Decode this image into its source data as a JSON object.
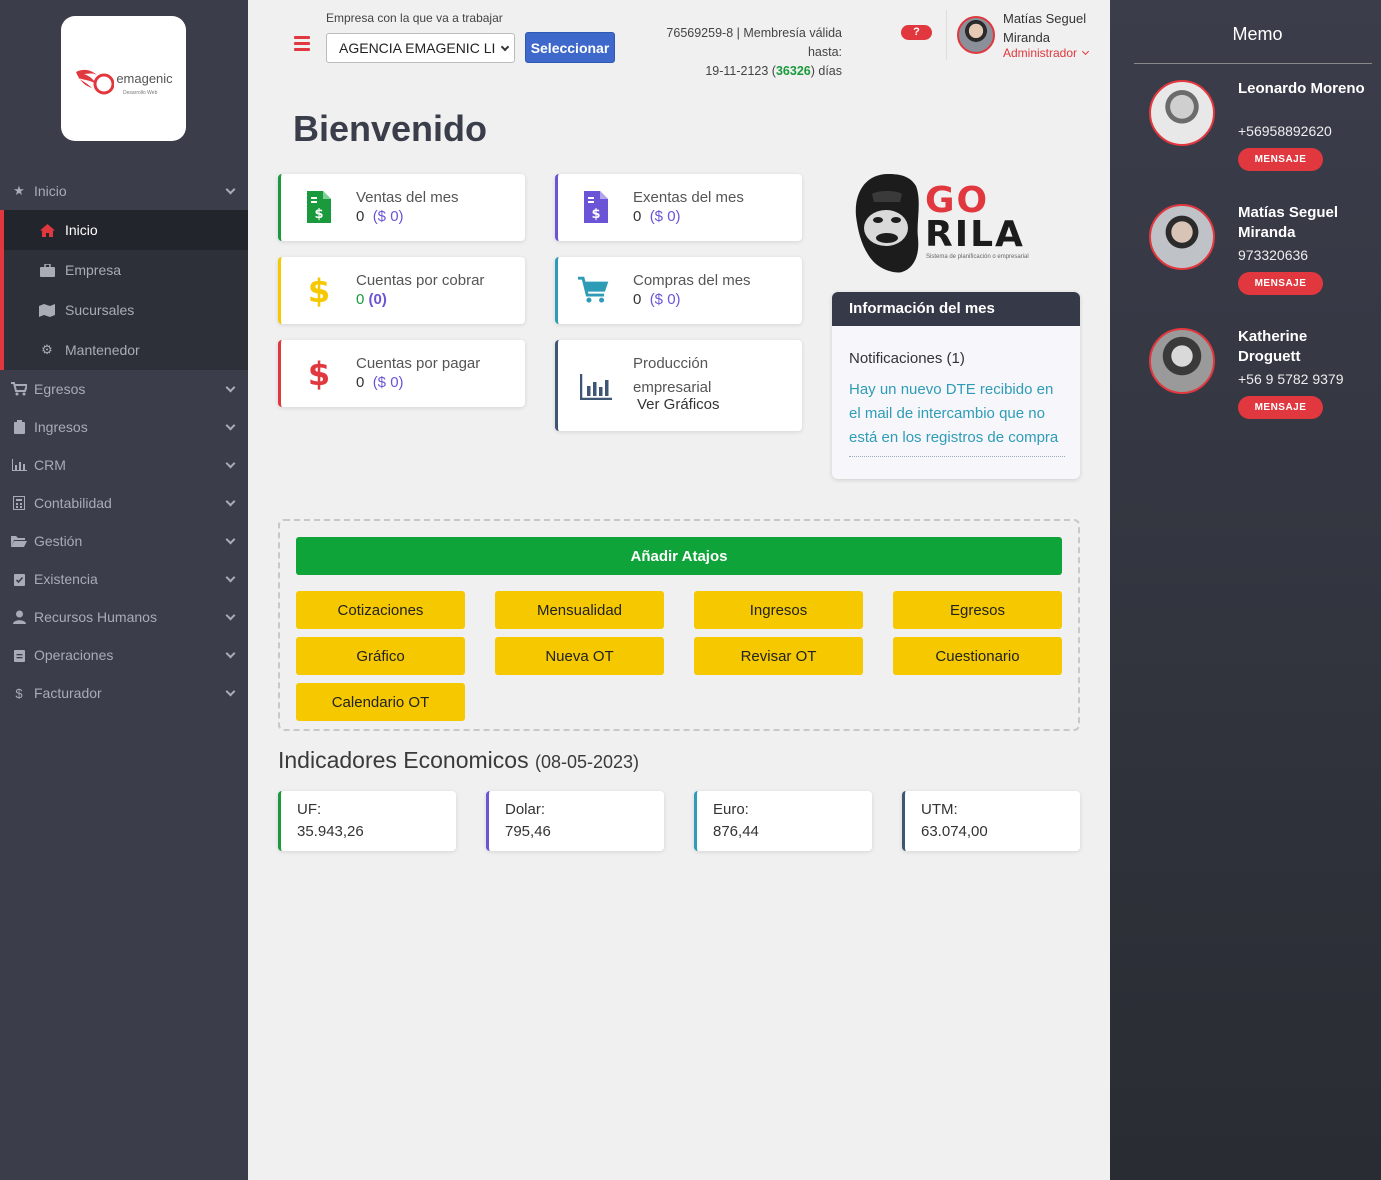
{
  "brand": {
    "logo_text": "emagenic",
    "logo_sub": "Desarrollo Web",
    "accent": "#e0383e"
  },
  "sidebar": {
    "groups": [
      {
        "label": "Inicio",
        "icon": "star-icon"
      },
      {
        "label": "Egresos",
        "icon": "cart-icon"
      },
      {
        "label": "Ingresos",
        "icon": "clipboard-icon"
      },
      {
        "label": "CRM",
        "icon": "bar-chart-icon"
      },
      {
        "label": "Contabilidad",
        "icon": "calculator-icon"
      },
      {
        "label": "Gestión",
        "icon": "folder-icon"
      },
      {
        "label": "Existencia",
        "icon": "clipboard-check-icon"
      },
      {
        "label": "Recursos Humanos",
        "icon": "user-icon"
      },
      {
        "label": "Operaciones",
        "icon": "clipboard-list-icon"
      },
      {
        "label": "Facturador",
        "icon": "dollar-icon"
      }
    ],
    "sub_items": [
      {
        "label": "Inicio",
        "icon": "home-icon"
      },
      {
        "label": "Empresa",
        "icon": "briefcase-icon"
      },
      {
        "label": "Sucursales",
        "icon": "map-icon"
      },
      {
        "label": "Mantenedor",
        "icon": "gear-icon"
      }
    ]
  },
  "header": {
    "company_label": "Empresa con la que va a trabajar",
    "company_selected": "AGENCIA EMAGENIC LI",
    "select_button": "Seleccionar",
    "membership_line1": "76569259-8 | Membresía válida",
    "membership_line2": "hasta:",
    "membership_date": "19-11-2123 (",
    "membership_days": "36326",
    "membership_suffix": ") días",
    "help": "?",
    "user_name": "Matías Seguel Miranda",
    "user_role": "Administrador"
  },
  "main": {
    "welcome": "Bienvenido",
    "cards": [
      {
        "title": "Ventas del mes",
        "count": "0",
        "amount": "($ 0)",
        "color": "#1a9a3c"
      },
      {
        "title": "Exentas del mes",
        "count": "0",
        "amount": "($ 0)",
        "color": "#6c54d6"
      },
      {
        "title": "Cuentas por cobrar",
        "count": "0",
        "amount": "(0)",
        "color": "#f5c800"
      },
      {
        "title": "Compras del mes",
        "count": "0",
        "amount": "($ 0)",
        "color": "#2f9cb7"
      },
      {
        "title": "Cuentas por pagar",
        "count": "0",
        "amount": "($ 0)",
        "color": "#e0383e"
      },
      {
        "title": "Producción empresarial",
        "link": "Ver Gráficos",
        "color": "#3e5573"
      }
    ],
    "gorila": {
      "line1": "GO",
      "line2": "RILA",
      "tagline": "Sistema de planificación o empresarial"
    },
    "info": {
      "title": "Información del mes",
      "notifications": "Notificaciones (1)",
      "message": "Hay un nuevo DTE recibido en el mail de intercambio que no está en los registros de compra"
    },
    "shortcuts": {
      "add_label": "Añadir Atajos",
      "buttons": [
        "Cotizaciones",
        "Mensualidad",
        "Ingresos",
        "Egresos",
        "Gráfico",
        "Nueva OT",
        "Revisar OT",
        "Cuestionario",
        "Calendario OT"
      ]
    },
    "indicators": {
      "title": "Indicadores Economicos",
      "date": "(08-05-2023)",
      "items": [
        {
          "label": "UF:",
          "value": "35.943,26",
          "color": "#1a9a3c"
        },
        {
          "label": "Dolar:",
          "value": "795,46",
          "color": "#6c54d6"
        },
        {
          "label": "Euro:",
          "value": "876,44",
          "color": "#2f9cb7"
        },
        {
          "label": "UTM:",
          "value": "63.074,00",
          "color": "#3e5573"
        }
      ]
    }
  },
  "memo": {
    "title": "Memo",
    "message_label": "MENSAJE",
    "contacts": [
      {
        "name": "Leonardo Moreno",
        "phone": "+56958892620"
      },
      {
        "name": "Matías Seguel Miranda",
        "phone": "973320636"
      },
      {
        "name": "Katherine Droguett",
        "phone": "+56 9 5782 9379"
      }
    ]
  }
}
